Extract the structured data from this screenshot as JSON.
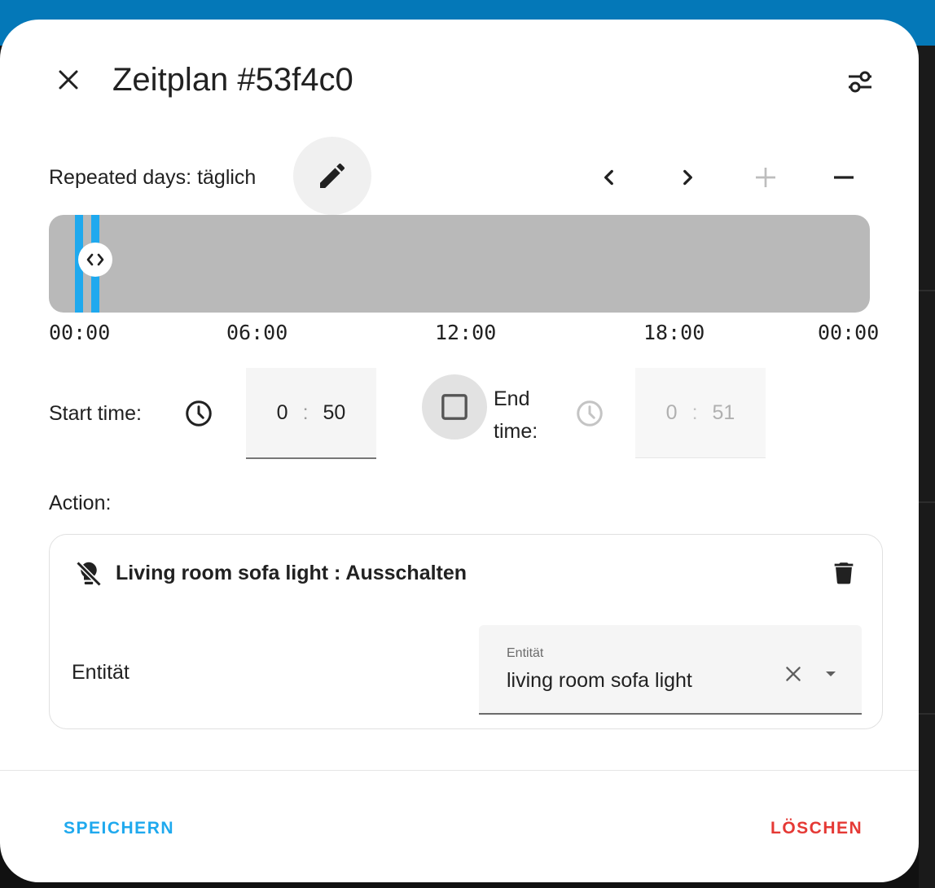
{
  "dialog": {
    "title": "Zeitplan #53f4c0"
  },
  "repeat": {
    "label": "Repeated days: täglich"
  },
  "timeline": {
    "ticks": [
      "00:00",
      "06:00",
      "12:00",
      "18:00",
      "00:00"
    ],
    "slot_start": "0:50",
    "slot_end": "0:51"
  },
  "start_time": {
    "label": "Start time:",
    "hours": "0",
    "minutes": "50",
    "separator": ":"
  },
  "end_time": {
    "label_line1": "End",
    "label_line2": "time:",
    "hours": "0",
    "minutes": "51",
    "separator": ":",
    "enabled": false
  },
  "action": {
    "label": "Action:",
    "title": "Living room sofa light : Ausschalten",
    "entity_row_label": "Entität",
    "entity_field_label": "Entität",
    "entity_value": "living room sofa light"
  },
  "footer": {
    "save_label": "SPEICHERN",
    "delete_label": "LÖSCHEN"
  },
  "colors": {
    "primary": "#1fa9ee",
    "delete": "#e53935",
    "header_bar": "#0478b8",
    "timeline_bg": "#b9b9b9"
  },
  "icons": {
    "close": "close-icon",
    "options": "tune-icon",
    "edit": "pencil-icon",
    "prev": "chevron-left-icon",
    "next": "chevron-right-icon",
    "add": "plus-icon",
    "remove": "minus-icon",
    "clock": "clock-icon",
    "checkbox": "checkbox-blank-icon",
    "light": "lightbulb-off-icon",
    "trash": "trash-icon",
    "clear": "close-icon",
    "dropdown": "menu-down-icon"
  }
}
